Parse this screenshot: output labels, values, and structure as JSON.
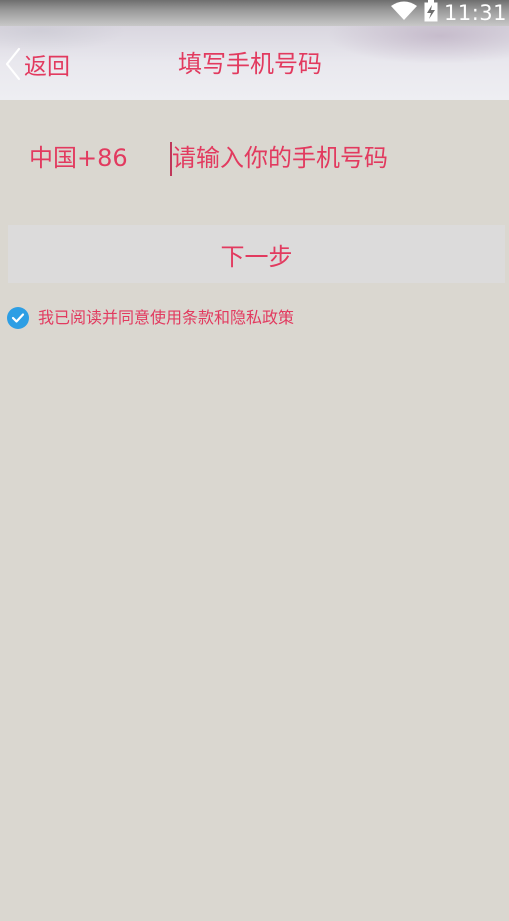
{
  "status_bar": {
    "time": "11:31",
    "icons": [
      "wifi-icon",
      "battery-charging-icon"
    ]
  },
  "header": {
    "back_label": "返回",
    "title": "填写手机号码"
  },
  "phone": {
    "country_code": "中国+86",
    "placeholder": "请输入你的手机号码",
    "value": ""
  },
  "next_button": {
    "label": "下一步"
  },
  "agreement": {
    "checked": true,
    "text": "我已阅读并同意使用条款和隐私政策"
  },
  "colors": {
    "accent": "#e23a5f",
    "check": "#2d9ee4",
    "background": "#dad7d0"
  }
}
